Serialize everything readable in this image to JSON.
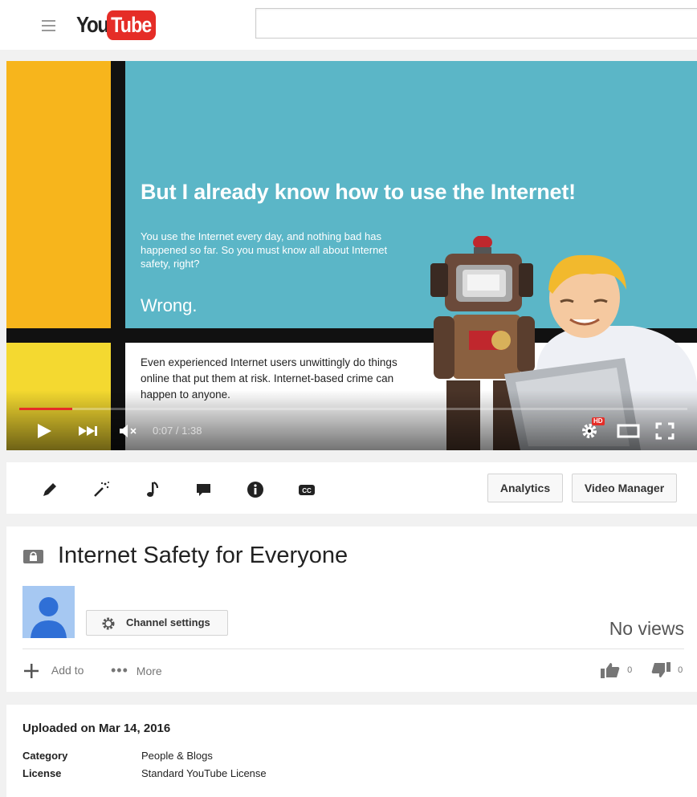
{
  "header": {
    "logo_you": "You",
    "logo_tube": "Tube",
    "search_placeholder": ""
  },
  "video": {
    "headline": "But I already know how to use the Internet!",
    "paragraph": "You use the Internet every day, and nothing bad has happened so far. So you must know all about Internet safety, right?",
    "wrong": "Wrong.",
    "paragraph2": "Even experienced Internet users unwittingly do things online that put them at risk. Internet-based crime can happen to anyone.",
    "time": "0:07 / 1:38",
    "progress_fraction": 0.079,
    "hd_badge": "HD"
  },
  "toolbar": {
    "analytics_label": "Analytics",
    "video_manager_label": "Video Manager"
  },
  "info": {
    "title": "Internet Safety for Everyone",
    "channel_settings_label": "Channel settings",
    "views": "No views",
    "add_to_label": "Add to",
    "more_label": "More",
    "likes": "0",
    "dislikes": "0"
  },
  "details": {
    "uploaded": "Uploaded on Mar 14, 2016",
    "category_label": "Category",
    "category_value": "People & Blogs",
    "license_label": "License",
    "license_value": "Standard YouTube License"
  },
  "colors": {
    "brand_red": "#e52d27",
    "teal": "#5bb6c7",
    "yellow": "#f7b51c"
  }
}
